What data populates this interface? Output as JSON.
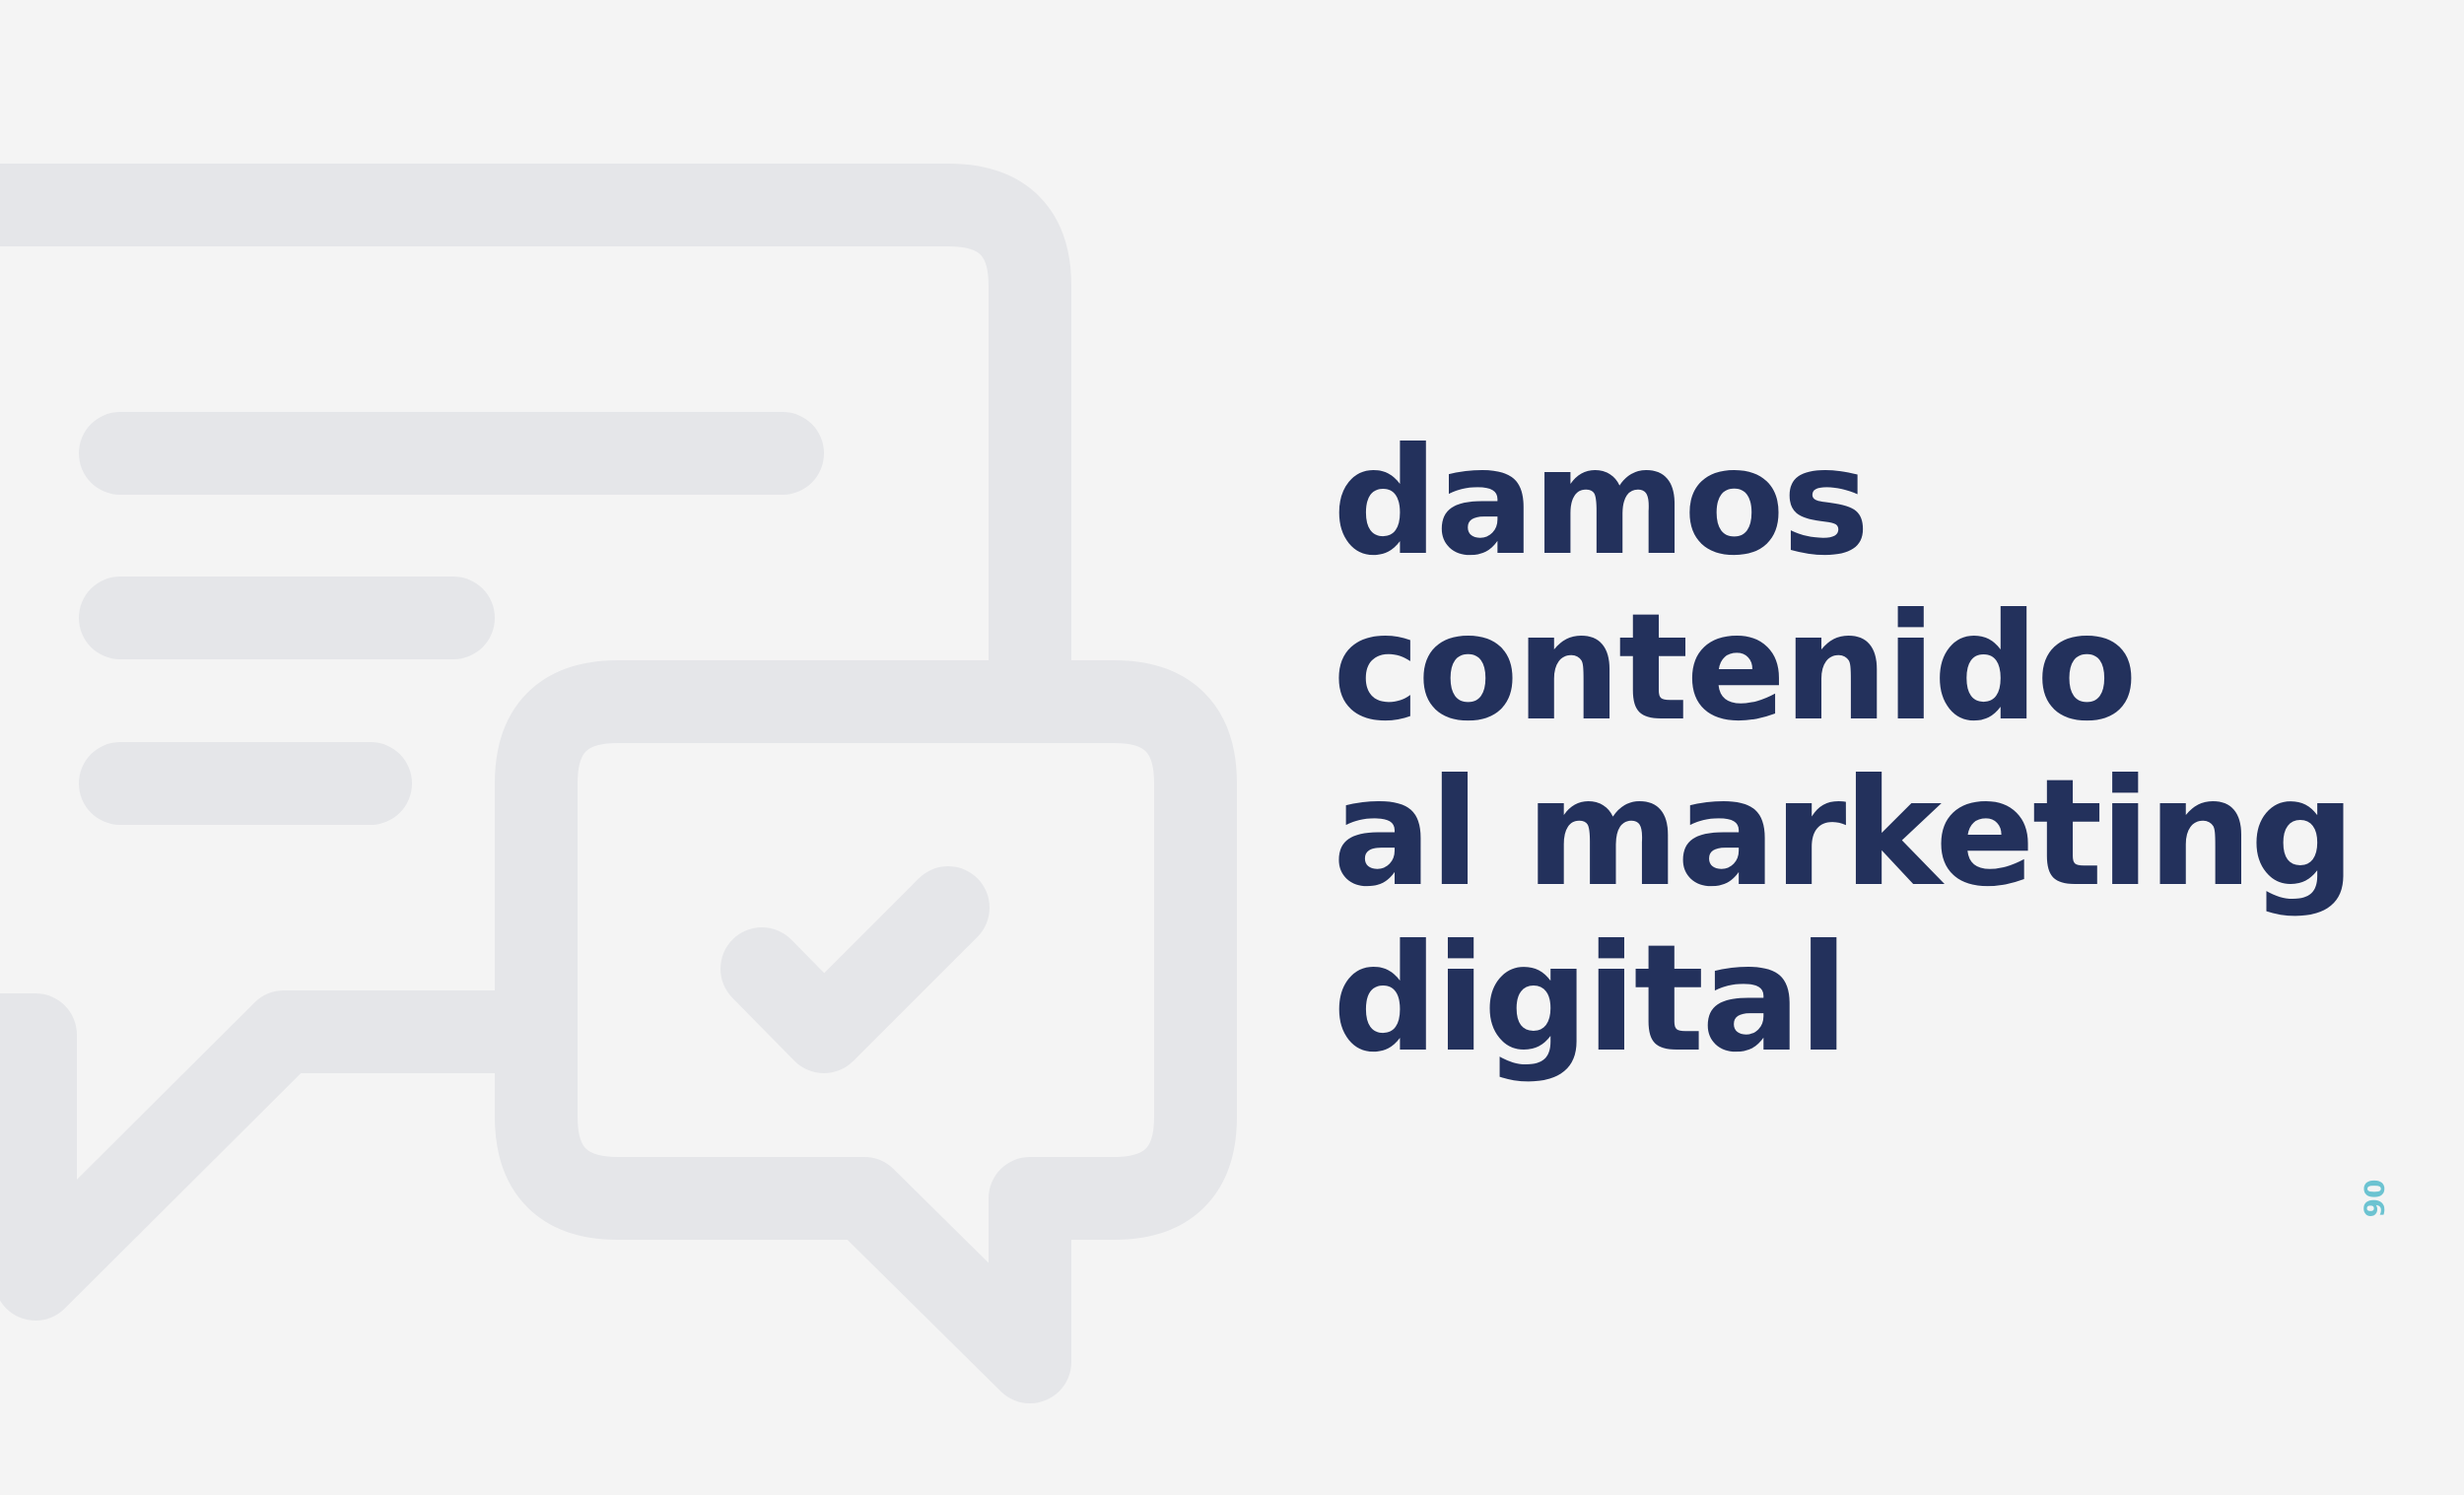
{
  "headline": {
    "lines": [
      "damos",
      "contenido",
      "al marketing",
      "digital"
    ]
  },
  "page_number": "06",
  "colors": {
    "background": "#f4f4f4",
    "illustration": "#e5e6e9",
    "headline": "#23315c",
    "page_number": "#6cc3d1"
  },
  "icons": [
    "chat-bubbles-check-icon"
  ]
}
